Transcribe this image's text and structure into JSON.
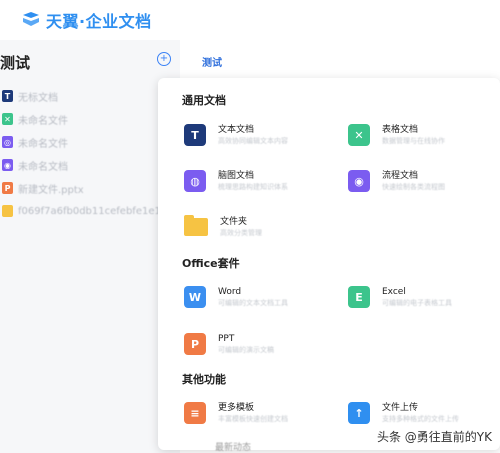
{
  "app": {
    "logo_text": "天翼·企业文档",
    "brand_color": "#2f8ff0"
  },
  "sidebar": {
    "space_title": "测试",
    "add_icon": "plus-circle-icon",
    "files": [
      {
        "label": "无标文档",
        "type": "doc",
        "color": "#1e3a7a",
        "glyph": "T"
      },
      {
        "label": "未命名文件",
        "type": "sheet",
        "color": "#3cc48c",
        "glyph": "✕"
      },
      {
        "label": "未命名文件",
        "type": "mindmap",
        "color": "#7b5cf0",
        "glyph": "◎"
      },
      {
        "label": "未命名文档",
        "type": "flow",
        "color": "#7b5cf0",
        "glyph": "◉"
      },
      {
        "label": "新建文件.pptx",
        "type": "ppt",
        "color": "#f07a45",
        "glyph": "P"
      },
      {
        "label": "f069f7a6fb0db11cefebfe1e14a6...",
        "type": "folder",
        "color": "#f6c343",
        "glyph": ""
      }
    ]
  },
  "main": {
    "tab_label": "测试"
  },
  "popup": {
    "sections": [
      {
        "title": "通用文档",
        "items": [
          {
            "title": "文本文档",
            "desc": "高效协同编辑文本内容",
            "icon": "text-doc-icon",
            "color": "#1e3a7a",
            "glyph": "T"
          },
          {
            "title": "表格文档",
            "desc": "数据管理与在线协作",
            "icon": "sheet-doc-icon",
            "color": "#3cc48c",
            "glyph": "✕"
          },
          {
            "title": "脑图文档",
            "desc": "梳理思路构建知识体系",
            "icon": "mindmap-doc-icon",
            "color": "#7b5cf0",
            "glyph": "◍"
          },
          {
            "title": "流程文档",
            "desc": "快速绘制各类流程图",
            "icon": "flow-doc-icon",
            "color": "#7b5cf0",
            "glyph": "◉"
          },
          {
            "title": "文件夹",
            "desc": "高效分类管理",
            "icon": "folder-icon",
            "color": "#f6c343",
            "glyph": ""
          }
        ]
      },
      {
        "title": "Office套件",
        "items": [
          {
            "title": "Word",
            "desc": "可编辑的文本文档工具",
            "icon": "word-icon",
            "color": "#3b8ff0",
            "glyph": "W"
          },
          {
            "title": "Excel",
            "desc": "可编辑的电子表格工具",
            "icon": "excel-icon",
            "color": "#3cc48c",
            "glyph": "E"
          },
          {
            "title": "PPT",
            "desc": "可编辑的演示文稿",
            "icon": "ppt-icon",
            "color": "#f07a45",
            "glyph": "P"
          }
        ]
      },
      {
        "title": "其他功能",
        "items": [
          {
            "title": "更多模板",
            "desc": "丰富模板快速创建文档",
            "icon": "template-icon",
            "color": "#f07a45",
            "glyph": "≡"
          },
          {
            "title": "文件上传",
            "desc": "支持多种格式的文件上传",
            "icon": "upload-icon",
            "color": "#2f8ff0",
            "glyph": "↑"
          }
        ]
      }
    ]
  },
  "peek_text": "最新动态",
  "watermark": "头条 @勇往直前的YK"
}
